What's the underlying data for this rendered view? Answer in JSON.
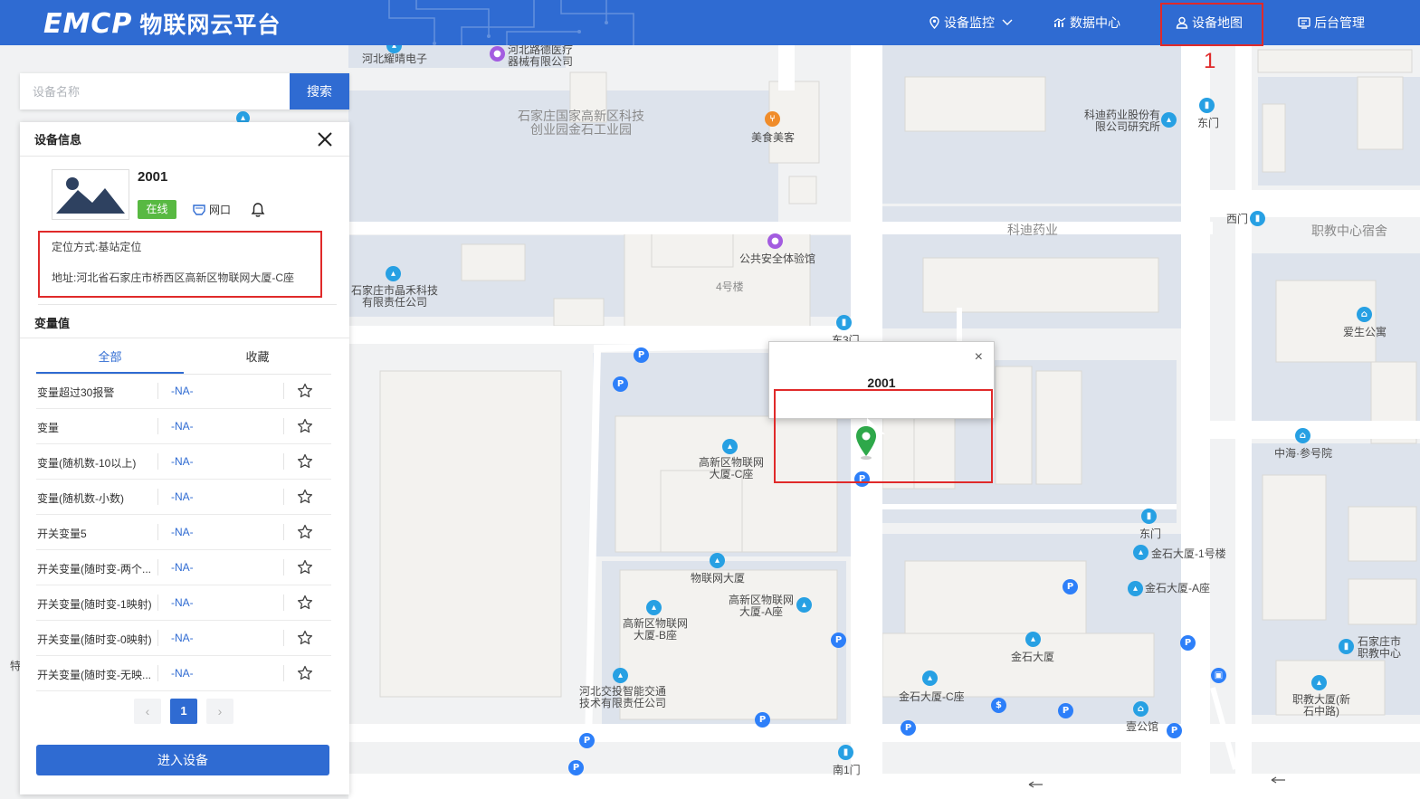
{
  "header": {
    "logo_emcp": "EMCP",
    "logo_text": "物联网云平台",
    "nav": [
      {
        "label": "设备监控",
        "icon": "location-pin-icon",
        "has_dropdown": true
      },
      {
        "label": "数据中心",
        "icon": "bar-chart-icon"
      },
      {
        "label": "设备地图",
        "icon": "user-icon",
        "active": true
      },
      {
        "label": "后台管理",
        "icon": "monitor-icon"
      }
    ],
    "annotation_number": "1"
  },
  "search": {
    "placeholder": "设备名称",
    "value": "",
    "button_label": "搜索"
  },
  "panel": {
    "title": "设备信息",
    "device_name": "2001",
    "status": "在线",
    "net_label": "网口",
    "location_method": "定位方式:基站定位",
    "address": "地址:河北省石家庄市桥西区高新区物联网大厦-C座",
    "variables_title": "变量值",
    "tabs": [
      "全部",
      "收藏"
    ],
    "rows": [
      {
        "name": "变量超过30报警",
        "value": "-NA-"
      },
      {
        "name": "变量",
        "value": "-NA-"
      },
      {
        "name": "变量(随机数-10以上)",
        "value": "-NA-"
      },
      {
        "name": "变量(随机数-小数)",
        "value": "-NA-"
      },
      {
        "name": "开关变量5",
        "value": "-NA-"
      },
      {
        "name": "开关变量(随时变-两个...",
        "value": "-NA-"
      },
      {
        "name": "开关变量(随时变-1映射)",
        "value": "-NA-"
      },
      {
        "name": "开关变量(随时变-0映射)",
        "value": "-NA-"
      },
      {
        "name": "开关变量(随时变-无映...",
        "value": "-NA-"
      }
    ],
    "pagination": {
      "prev": "‹",
      "current": "1",
      "next": "›"
    },
    "enter_button": "进入设备"
  },
  "popup": {
    "device_name": "2001",
    "close": "×"
  },
  "map_labels": [
    {
      "text": "河北耀晴电子",
      "kind": "poi"
    },
    {
      "text": "河北路德医疗器械有限公司",
      "kind": "poi"
    },
    {
      "text": "石家庄国家高新区科技创业园金石工业园",
      "kind": "area"
    },
    {
      "text": "美食美客",
      "kind": "poi"
    },
    {
      "text": "科迪药业股份有限公司研究所",
      "kind": "poi"
    },
    {
      "text": "东门",
      "kind": "poi"
    },
    {
      "text": "西门",
      "kind": "poi"
    },
    {
      "text": "科迪药业",
      "kind": "area"
    },
    {
      "text": "职教中心宿舍",
      "kind": "area"
    },
    {
      "text": "公共安全体验馆",
      "kind": "poi"
    },
    {
      "text": "石家庄市晶禾科技有限责任公司",
      "kind": "poi"
    },
    {
      "text": "4号楼",
      "kind": "area"
    },
    {
      "text": "东3门",
      "kind": "poi"
    },
    {
      "text": "爱生公寓",
      "kind": "poi"
    },
    {
      "text": "高新区物联网大厦-C座",
      "kind": "poi"
    },
    {
      "text": "中海·参号院",
      "kind": "poi"
    },
    {
      "text": "东门",
      "kind": "poi"
    },
    {
      "text": "金石大厦-1号楼",
      "kind": "poi"
    },
    {
      "text": "物联网大厦",
      "kind": "poi"
    },
    {
      "text": "高新区物联网大厦-A座",
      "kind": "poi"
    },
    {
      "text": "金石大厦-A座",
      "kind": "poi"
    },
    {
      "text": "高新区物联网大厦-B座",
      "kind": "poi"
    },
    {
      "text": "金石大厦",
      "kind": "poi"
    },
    {
      "text": "石家庄市职教中心",
      "kind": "poi"
    },
    {
      "text": "河北交投智能交通技术有限责任公司",
      "kind": "poi"
    },
    {
      "text": "金石大厦-C座",
      "kind": "poi"
    },
    {
      "text": "壹公馆",
      "kind": "poi"
    },
    {
      "text": "职教大厦(新石中路)",
      "kind": "poi"
    },
    {
      "text": "南1门",
      "kind": "poi"
    },
    {
      "text": "特",
      "kind": "poi"
    }
  ],
  "colors": {
    "header_bg": "#2f6bd2",
    "accent": "#2f6bd2",
    "online": "#58b942",
    "highlight_red": "#e02a2a",
    "marker_green": "#2ea84a"
  }
}
